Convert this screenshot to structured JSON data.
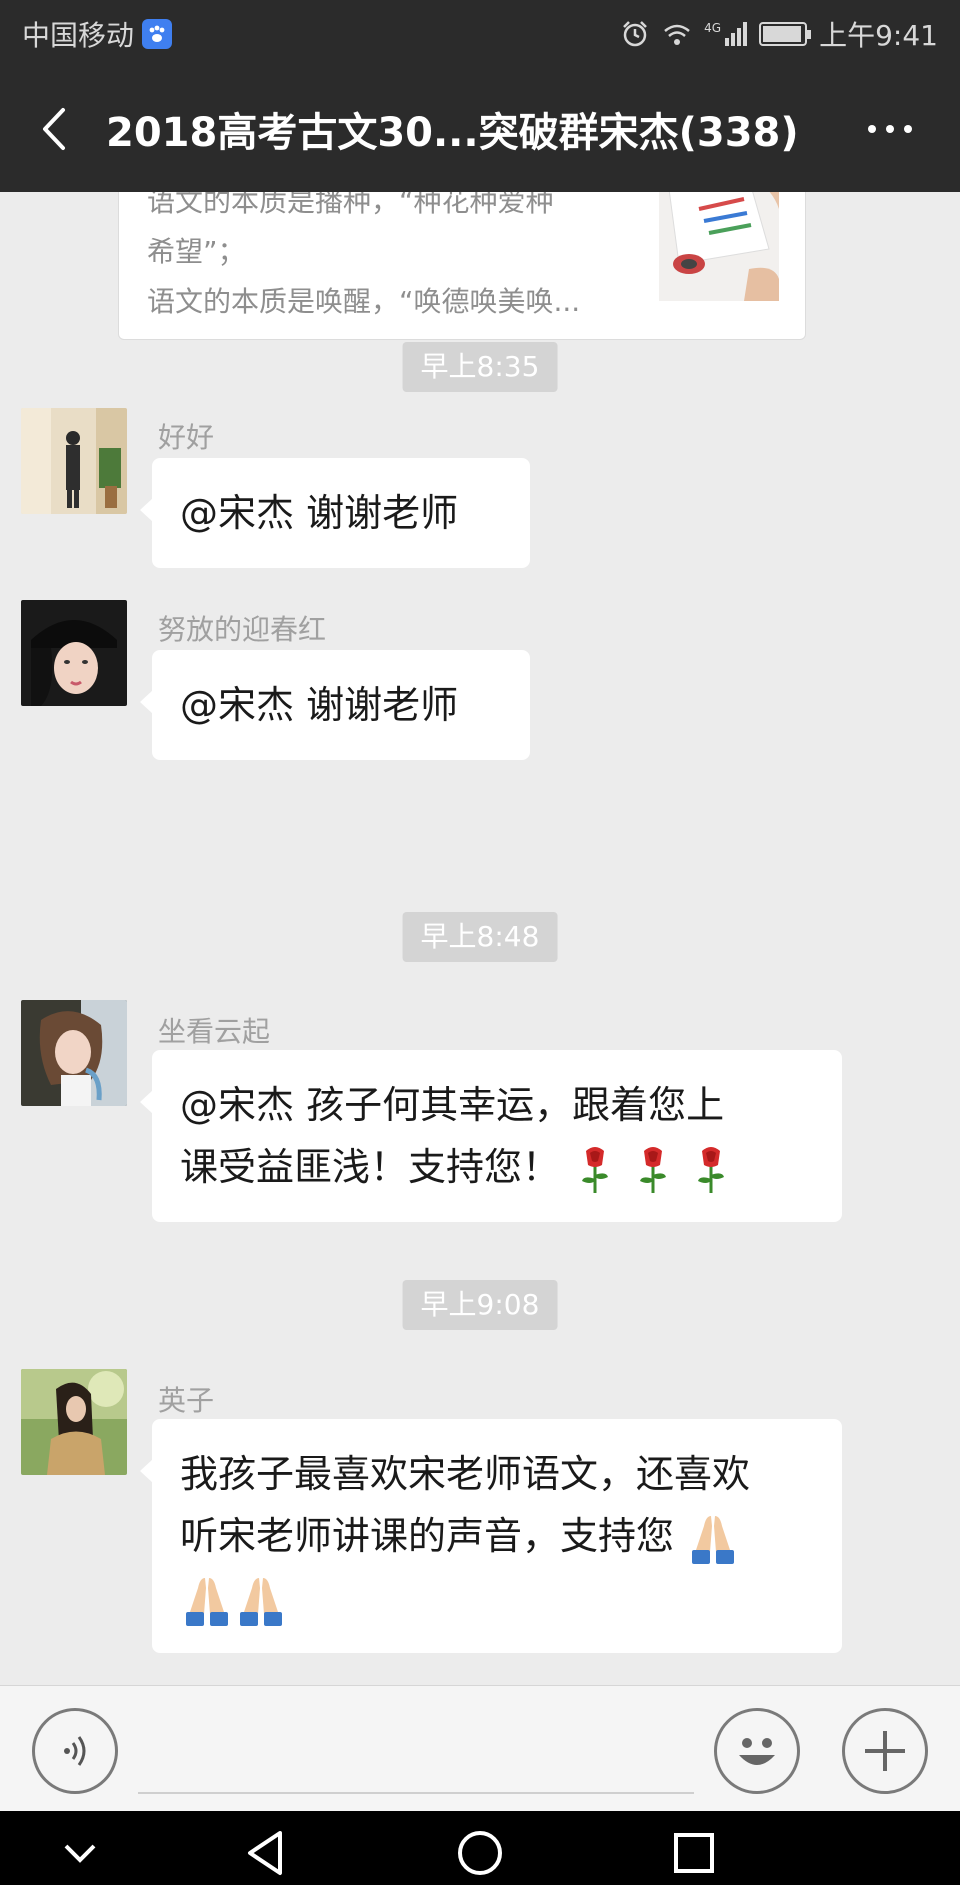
{
  "status_bar": {
    "carrier": "中国移动",
    "network": "4G",
    "time": "上午9:41"
  },
  "header": {
    "title": "2018高考古文30...突破群宋杰(338)"
  },
  "article_card": {
    "lines": [
      "语文的本质是播种，“种花种爱种",
      "希望”；",
      "语文的本质是唤醒，“唤德唤美唤..."
    ]
  },
  "timestamps": [
    "早上8:35",
    "早上8:48",
    "早上9:08"
  ],
  "messages": [
    {
      "sender": "好好",
      "text": "@宋杰  谢谢老师"
    },
    {
      "sender": "努放的迎春红",
      "text": "@宋杰  谢谢老师"
    },
    {
      "sender": "坐看云起",
      "line1": "@宋杰  孩子何其幸运，跟着您上",
      "line2": "课受益匪浅！支持您！"
    },
    {
      "sender": "英子",
      "line1": "我孩子最喜欢宋老师语文，还喜欢",
      "line2": "听宋老师讲课的声音，支持您"
    }
  ],
  "emoji": {
    "rose": "rose-icon",
    "pray": "folded-hands-icon"
  },
  "colors": {
    "header_bg": "#2b2b2b",
    "chat_bg": "#ececec",
    "bubble_bg": "#ffffff",
    "timestamp_bg": "#d4d4d4"
  }
}
